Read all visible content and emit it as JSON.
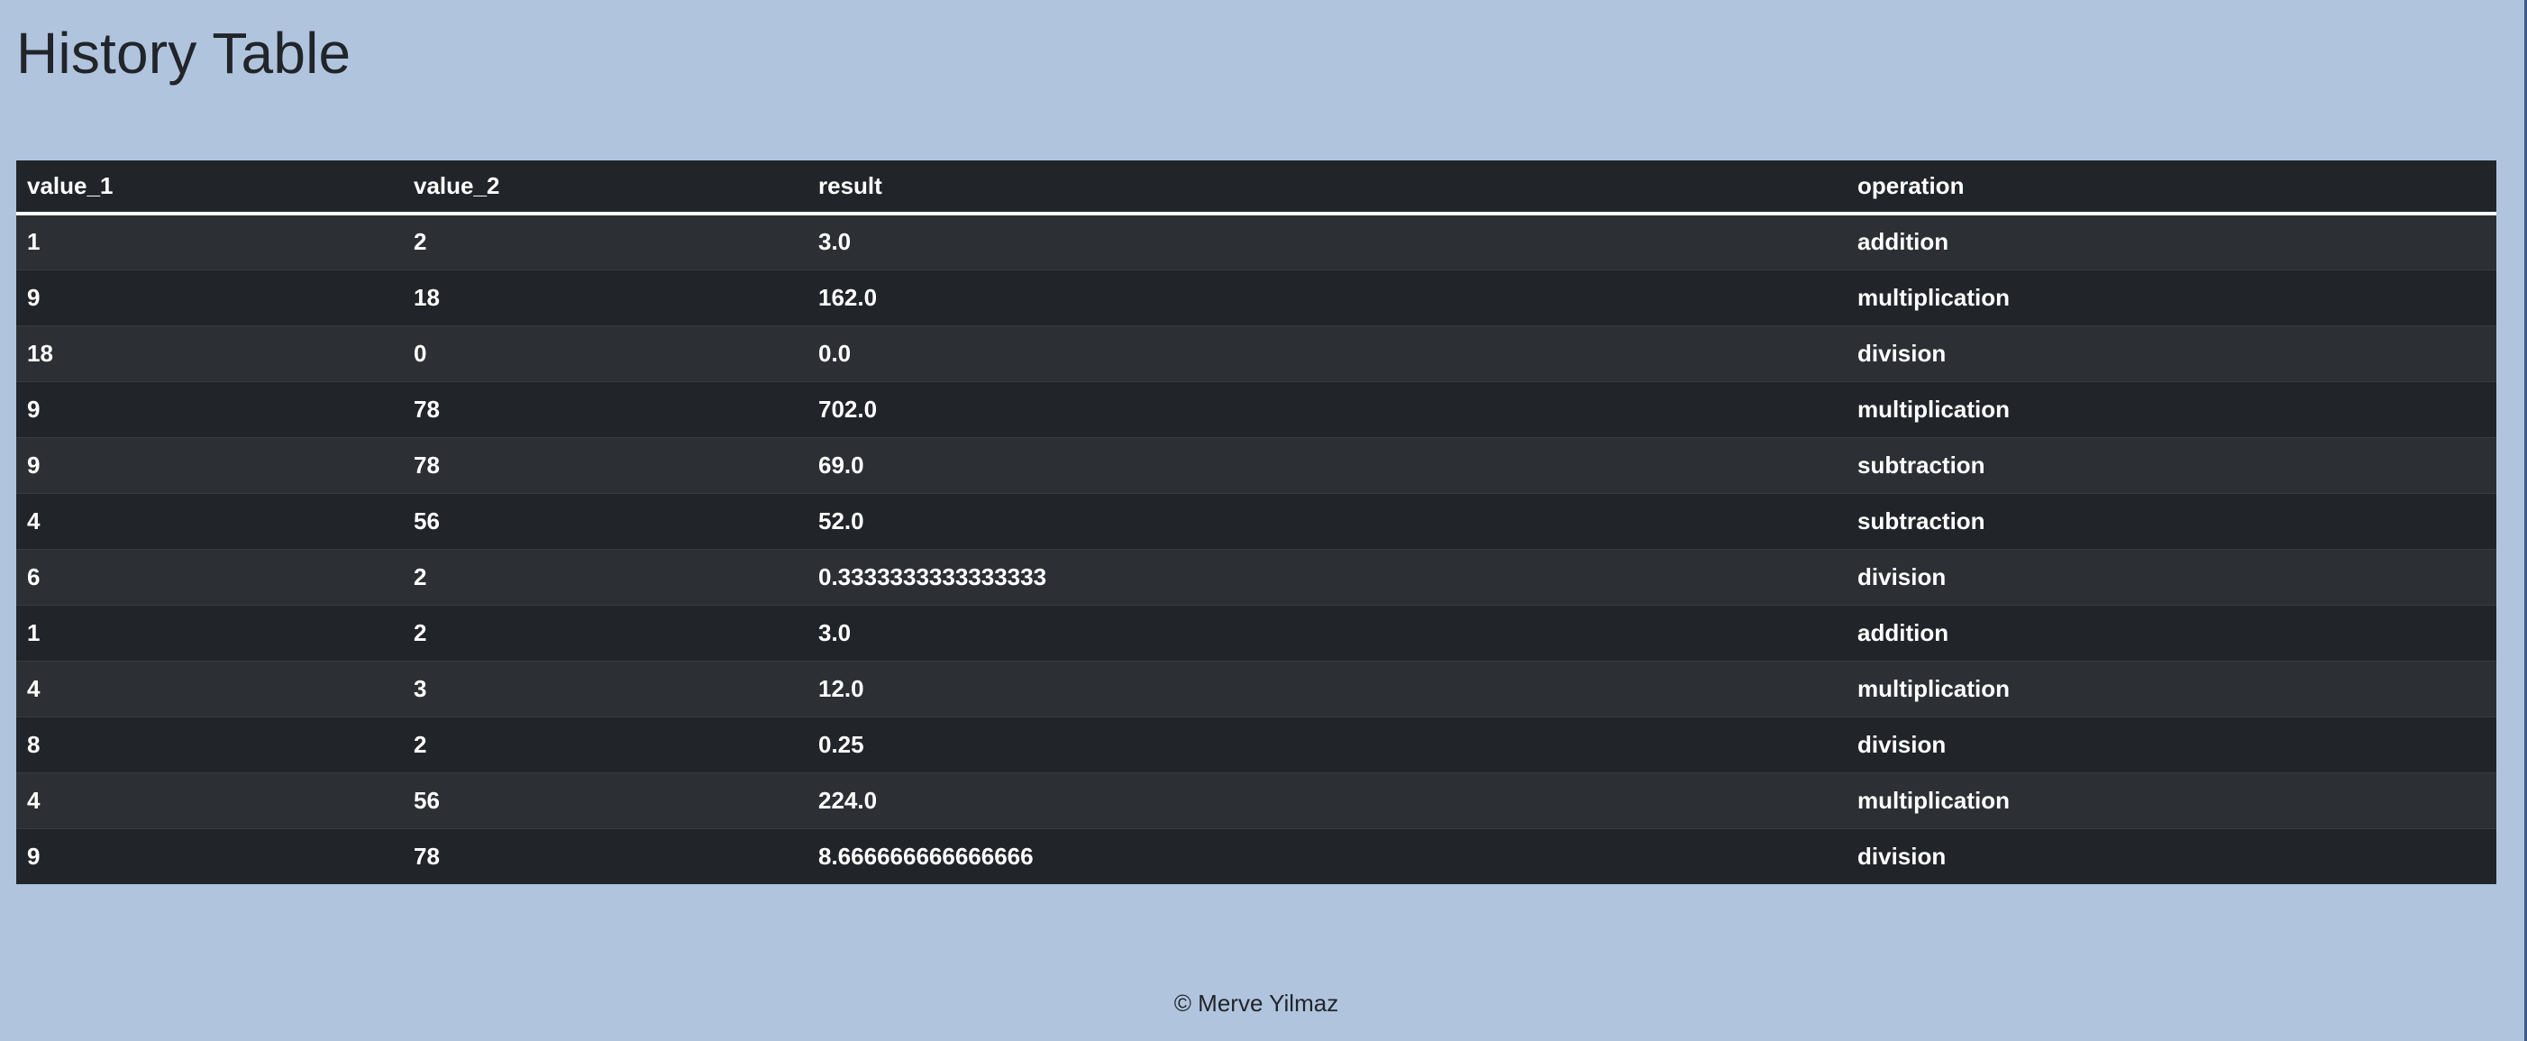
{
  "page": {
    "title": "History Table"
  },
  "table": {
    "headers": [
      "value_1",
      "value_2",
      "result",
      "operation"
    ],
    "rows": [
      [
        "1",
        "2",
        "3.0",
        "addition"
      ],
      [
        "9",
        "18",
        "162.0",
        "multiplication"
      ],
      [
        "18",
        "0",
        "0.0",
        "division"
      ],
      [
        "9",
        "78",
        "702.0",
        "multiplication"
      ],
      [
        "9",
        "78",
        "69.0",
        "subtraction"
      ],
      [
        "4",
        "56",
        "52.0",
        "subtraction"
      ],
      [
        "6",
        "2",
        "0.3333333333333333",
        "division"
      ],
      [
        "1",
        "2",
        "3.0",
        "addition"
      ],
      [
        "4",
        "3",
        "12.0",
        "multiplication"
      ],
      [
        "8",
        "2",
        "0.25",
        "division"
      ],
      [
        "4",
        "56",
        "224.0",
        "multiplication"
      ],
      [
        "9",
        "78",
        "8.666666666666666",
        "division"
      ]
    ]
  },
  "footer": {
    "text": "© Merve Yilmaz"
  },
  "colors": {
    "page_background": "#b0c4de",
    "table_dark": "#212529",
    "table_striped": "#2c3034",
    "text_light": "#ffffff",
    "text_dark": "#212529"
  }
}
